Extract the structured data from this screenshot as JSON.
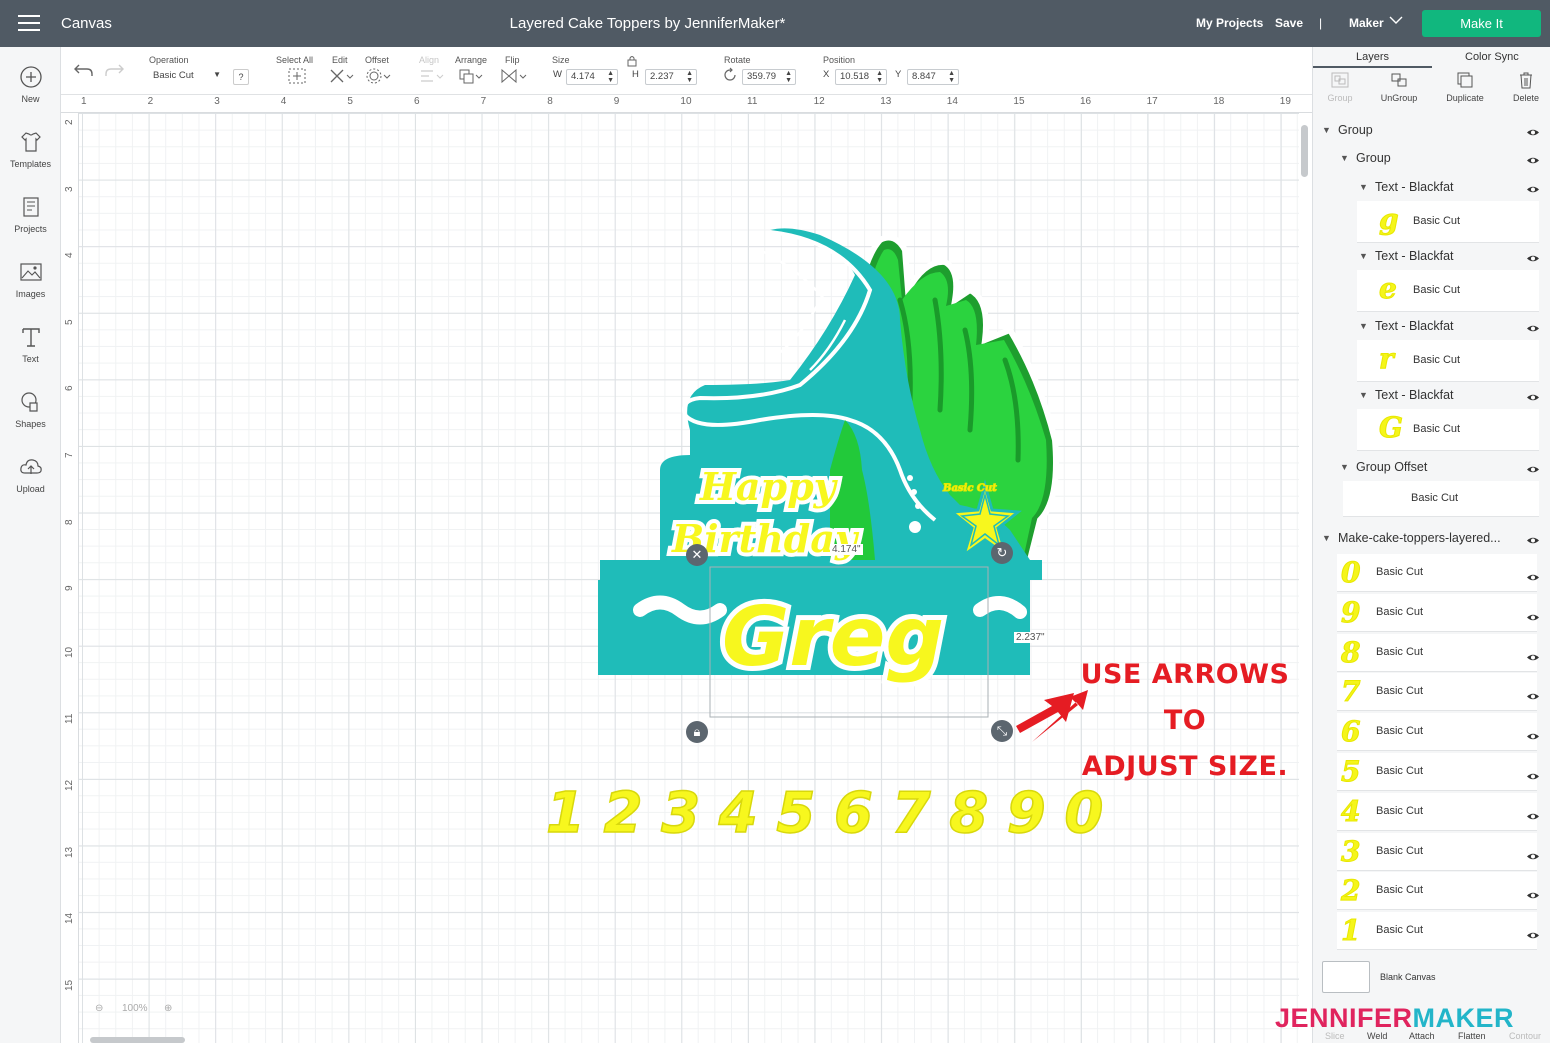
{
  "topbar": {
    "app_title": "Canvas",
    "project_title": "Layered Cake Toppers by JenniferMaker*",
    "my_projects": "My Projects",
    "save": "Save",
    "divider": "|",
    "machine": "Maker",
    "make_it": "Make It"
  },
  "leftrail": {
    "items": [
      {
        "label": "New",
        "icon": "plus-icon"
      },
      {
        "label": "Templates",
        "icon": "shirt-icon"
      },
      {
        "label": "Projects",
        "icon": "projects-icon"
      },
      {
        "label": "Images",
        "icon": "image-icon"
      },
      {
        "label": "Text",
        "icon": "text-icon"
      },
      {
        "label": "Shapes",
        "icon": "shapes-icon"
      },
      {
        "label": "Upload",
        "icon": "upload-icon"
      }
    ]
  },
  "toolbar": {
    "operation_label": "Operation",
    "operation_value": "Basic Cut",
    "help": "?",
    "select_all": "Select All",
    "edit": "Edit",
    "offset": "Offset",
    "align": "Align",
    "arrange": "Arrange",
    "flip": "Flip",
    "size_label": "Size",
    "w_label": "W",
    "w_value": "4.174",
    "h_label": "H",
    "h_value": "2.237",
    "rotate_label": "Rotate",
    "rotate_value": "359.79",
    "position_label": "Position",
    "x_label": "X",
    "x_value": "10.518",
    "y_label": "Y",
    "y_value": "8.847"
  },
  "ruler": {
    "top": [
      "1",
      "2",
      "3",
      "4",
      "5",
      "6",
      "7",
      "8",
      "9",
      "10",
      "11",
      "12",
      "13",
      "14",
      "15",
      "16",
      "17",
      "18",
      "19"
    ],
    "left": [
      "2",
      "3",
      "4",
      "5",
      "6",
      "7",
      "8",
      "9",
      "10",
      "11",
      "12",
      "13",
      "14",
      "15"
    ]
  },
  "canvas": {
    "happy": "Happy",
    "birthday": "Birthday",
    "name": "Greg",
    "width_readout": "4.174\"",
    "height_readout": "2.237\"",
    "numerals": [
      "1",
      "2",
      "3",
      "4",
      "5",
      "6",
      "7",
      "8",
      "9",
      "0"
    ],
    "annotation_line1": "USE ARROWS TO",
    "annotation_line2": "ADJUST SIZE.",
    "zoom": "100%",
    "watermark_a": "JENNIFER",
    "watermark_b": "MAKER",
    "colors": {
      "teal": "#1fbcb9",
      "green": "#22c93a",
      "yellow": "#f7f71e",
      "annotation": "#e51c23"
    }
  },
  "rightpanel": {
    "tab_layers": "Layers",
    "tab_color_sync": "Color Sync",
    "actions": {
      "group": "Group",
      "ungroup": "UnGroup",
      "duplicate": "Duplicate",
      "delete": "Delete"
    },
    "tree": {
      "group1": "Group",
      "group2": "Group",
      "text_layers": [
        {
          "name": "Text - Blackfat",
          "cut": "Basic Cut",
          "glyph": "g"
        },
        {
          "name": "Text - Blackfat",
          "cut": "Basic Cut",
          "glyph": "e"
        },
        {
          "name": "Text - Blackfat",
          "cut": "Basic Cut",
          "glyph": "r"
        },
        {
          "name": "Text - Blackfat",
          "cut": "Basic Cut",
          "glyph": "G"
        }
      ],
      "group_offset": "Group Offset",
      "group_offset_cut": "Basic Cut",
      "file_group": "Make-cake-toppers-layered...",
      "numeral_layers": [
        {
          "glyph": "0",
          "cut": "Basic Cut"
        },
        {
          "glyph": "9",
          "cut": "Basic Cut"
        },
        {
          "glyph": "8",
          "cut": "Basic Cut"
        },
        {
          "glyph": "7",
          "cut": "Basic Cut"
        },
        {
          "glyph": "6",
          "cut": "Basic Cut"
        },
        {
          "glyph": "5",
          "cut": "Basic Cut"
        },
        {
          "glyph": "4",
          "cut": "Basic Cut"
        },
        {
          "glyph": "3",
          "cut": "Basic Cut"
        },
        {
          "glyph": "2",
          "cut": "Basic Cut"
        },
        {
          "glyph": "1",
          "cut": "Basic Cut"
        }
      ]
    },
    "blank_canvas": "Blank Canvas",
    "bottom_actions": {
      "slice": "Slice",
      "weld": "Weld",
      "attach": "Attach",
      "flatten": "Flatten",
      "contour": "Contour"
    }
  }
}
